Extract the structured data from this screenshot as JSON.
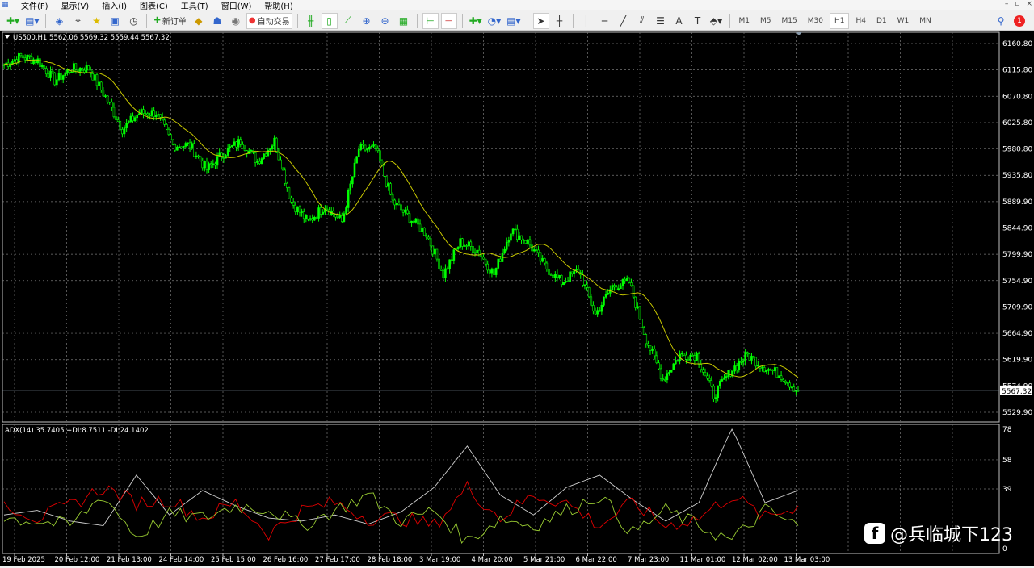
{
  "menu": {
    "items": [
      "文件(F)",
      "显示(V)",
      "插入(I)",
      "图表(C)",
      "工具(T)",
      "窗口(W)",
      "帮助(H)"
    ]
  },
  "toolbar": {
    "new_order": "新订单",
    "auto_trading": "自动交易",
    "timeframes": [
      "M1",
      "M5",
      "M15",
      "M30",
      "H1",
      "H4",
      "D1",
      "W1",
      "MN"
    ],
    "active_timeframe": "H1",
    "notification_count": "1"
  },
  "chart": {
    "info": "US500,H1  5562.06 5569.32 5559.44 5567.32",
    "current_price": "5567.32",
    "price_labels": [
      "6160.80",
      "6115.80",
      "6070.80",
      "6025.80",
      "5980.80",
      "5935.80",
      "5889.90",
      "5844.90",
      "5799.90",
      "5754.90",
      "5709.90",
      "5664.90",
      "5619.90",
      "5574.90",
      "5529.90"
    ],
    "indicator_info": "ADX(14) 35.7405 +DI:8.7511 -DI:24.1402",
    "indicator_labels": [
      "78",
      "58",
      "39",
      "0"
    ],
    "time_labels": [
      "19 Feb 2025",
      "20 Feb 12:00",
      "21 Feb 13:00",
      "24 Feb 14:00",
      "25 Feb 15:00",
      "26 Feb 16:00",
      "27 Feb 17:00",
      "28 Feb 18:00",
      "3 Mar 19:00",
      "4 Mar 20:00",
      "5 Mar 21:00",
      "6 Mar 22:00",
      "7 Mar 23:00",
      "11 Mar 01:00",
      "12 Mar 02:00",
      "13 Mar 03:00"
    ],
    "colors": {
      "candles": "#00ff00",
      "ma": "#c8c800",
      "adx": "#d0d0d0",
      "plus_di": "#9acd32",
      "minus_di": "#e00000"
    }
  },
  "chart_data": {
    "type": "line",
    "title": "US500,H1",
    "price": {
      "ylim": [
        5510,
        6175
      ],
      "values": [
        6124.9,
        6138.7,
        6131.8,
        6097.3,
        6118,
        6118,
        6069.7,
        6014.5,
        6042.1,
        6042.1,
        5986.9,
        5986.9,
        5945.4,
        5973.1,
        5993.8,
        5959.2,
        5993.8,
        5890.2,
        5855.7,
        5883.3,
        5855.7,
        5980,
        5980,
        5890.2,
        5862.6,
        5835,
        5766,
        5821.2,
        5807.4,
        5766,
        5841.9,
        5821.2,
        5779.8,
        5752.4,
        5773.1,
        5697,
        5745.3,
        5752.4,
        5655.5,
        5586.5,
        5627.9,
        5627.9,
        5558.9,
        5600.3,
        5627.9,
        5607.2,
        5593.4,
        5565.8
      ]
    },
    "adx": {
      "ylim": [
        0,
        78
      ],
      "series": [
        {
          "name": "ADX",
          "values": [
            22,
            25,
            18,
            15,
            48,
            22,
            38,
            28,
            20,
            18,
            22,
            16,
            24,
            40,
            67,
            35,
            22,
            40,
            48,
            32,
            18,
            30,
            79,
            30,
            38
          ]
        },
        {
          "name": "-DI",
          "values": [
            30,
            20,
            28,
            40,
            30,
            32,
            20,
            30,
            10,
            25,
            30,
            20,
            20,
            15,
            40,
            20,
            35,
            30,
            15,
            30,
            15,
            20,
            35,
            20,
            28
          ]
        },
        {
          "name": "+DI",
          "values": [
            20,
            18,
            15,
            35,
            8,
            22,
            20,
            28,
            26,
            15,
            25,
            35,
            18,
            25,
            5,
            20,
            15,
            25,
            35,
            10,
            25,
            15,
            5,
            25,
            15
          ]
        }
      ]
    }
  },
  "watermark": "@兵临城下123"
}
